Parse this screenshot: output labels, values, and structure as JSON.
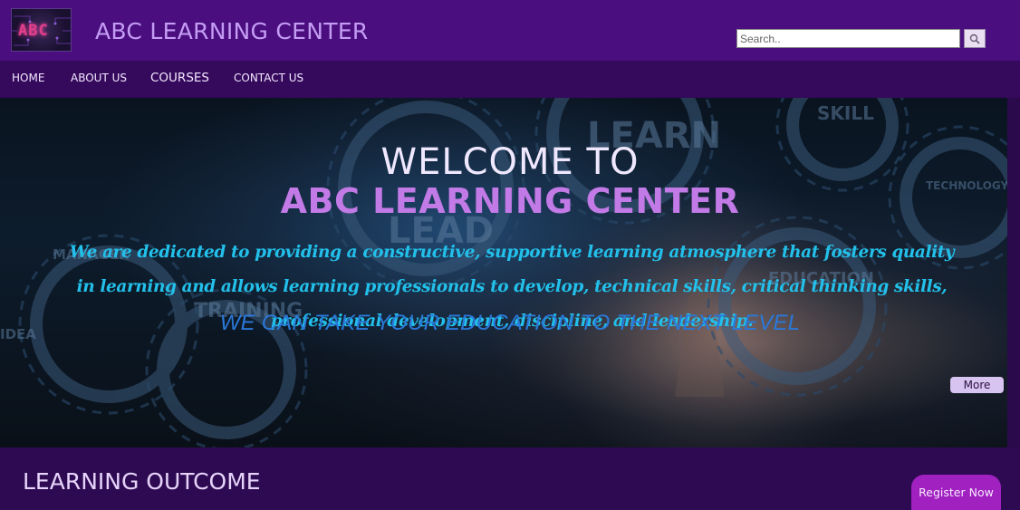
{
  "header": {
    "logo_text": "ABC",
    "site_title": "ABC LEARNING CENTER",
    "search": {
      "placeholder": "Search.."
    }
  },
  "nav": {
    "items": [
      {
        "label": "HOME"
      },
      {
        "label": "ABOUT US"
      },
      {
        "label": "COURSES"
      },
      {
        "label": "CONTACT US"
      }
    ]
  },
  "hero": {
    "welcome": "WELCOME TO",
    "name": "ABC LEARNING CENTER",
    "description": "We are dedicated to providing a constructive, supportive learning atmosphere that fosters quality in learning and allows learning professionals to develop, technical skills, critical thinking skills, professional development, discipline, and leadership.",
    "tagline": "WE CAN TAKE YOUR EDUCATION TO THE NEXT LEVEL",
    "more_label": "More",
    "background_words": [
      "LEARN",
      "SKILL",
      "TECHNOLOGY",
      "MANAGER",
      "LEAD",
      "TRAINING",
      "IDEA",
      "EDUCATION"
    ]
  },
  "section": {
    "title": "LEARNING OUTCOME",
    "register_label": "Register Now"
  },
  "colors": {
    "header_bg": "#4a0e7e",
    "nav_bg": "#35095c",
    "page_bg": "#2a0a4a",
    "accent_purple": "#c27ae6",
    "description_cyan": "#22c0ea",
    "tagline_blue": "#2a78d8",
    "register_magenta": "#a020c0"
  },
  "icons": {
    "search": "search-icon"
  }
}
